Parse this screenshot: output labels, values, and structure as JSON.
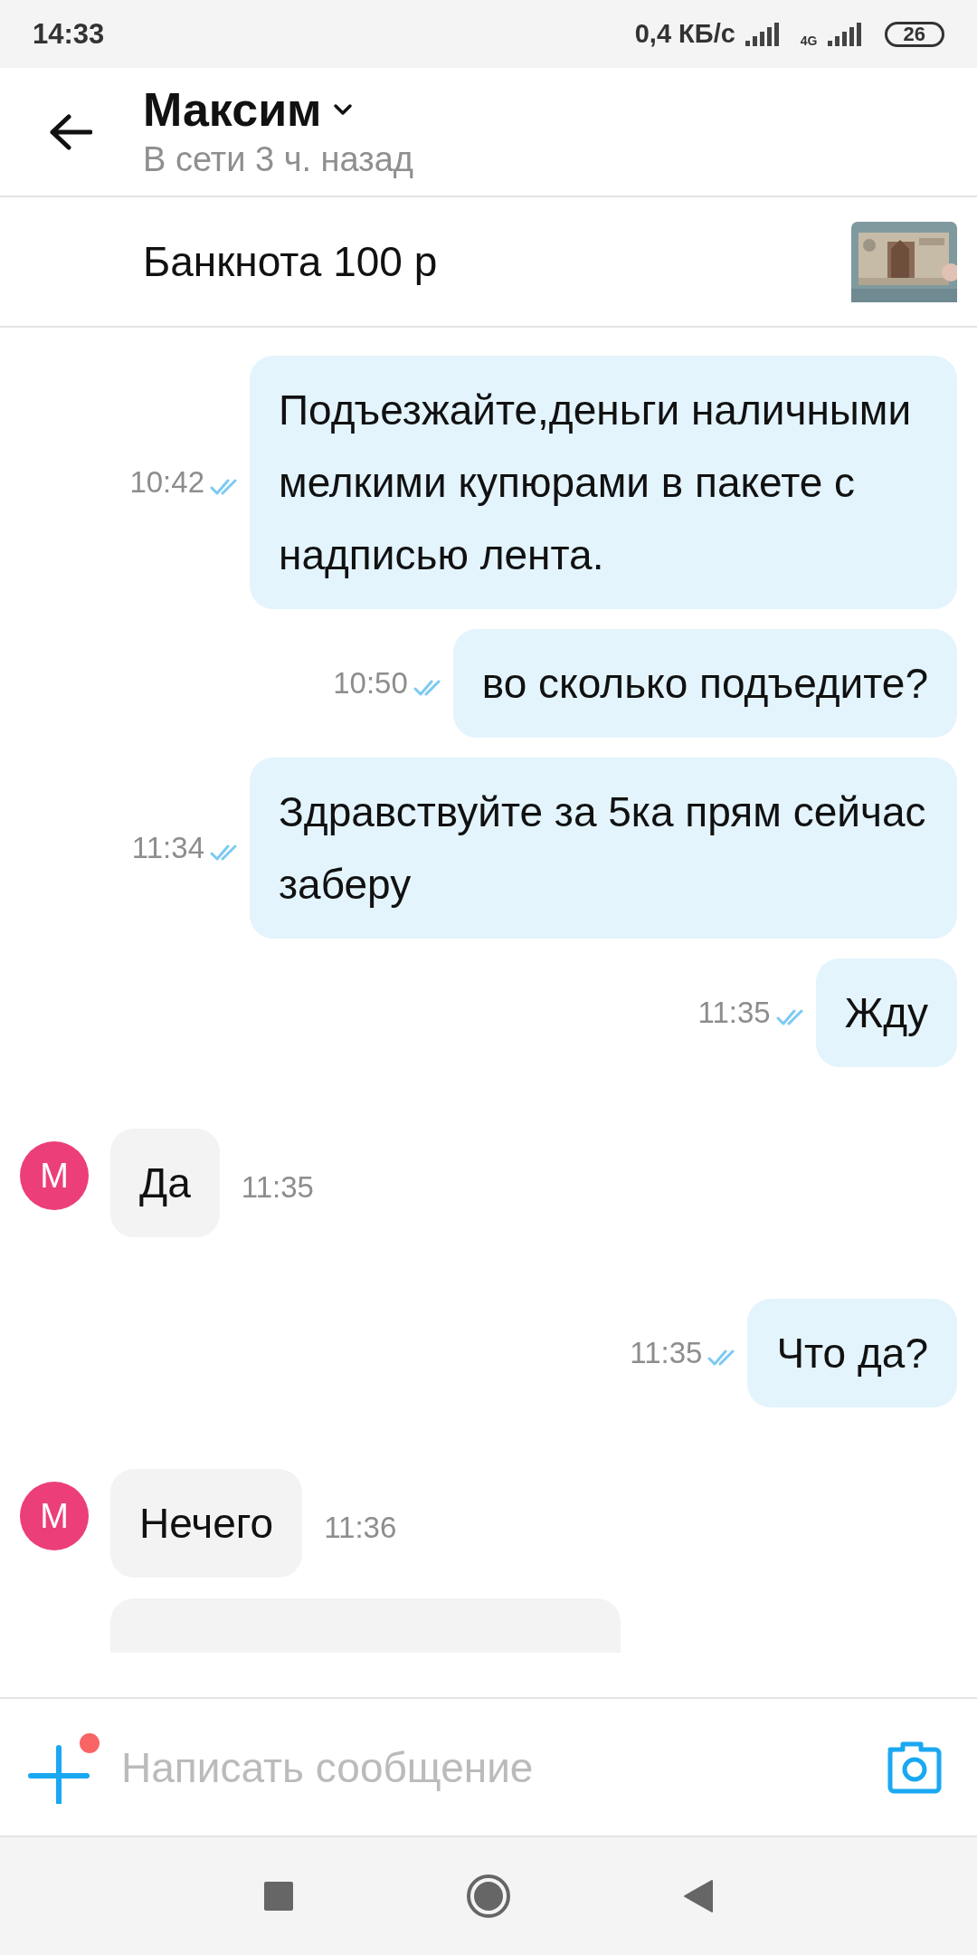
{
  "status_bar": {
    "time": "14:33",
    "speed": "0,4 КБ/с",
    "network": "4G",
    "battery": "26"
  },
  "header": {
    "name": "Максим",
    "subtitle": "В сети 3 ч. назад"
  },
  "listing": {
    "title": "Банкнота 100 р"
  },
  "messages": [
    {
      "kind": "outgoing",
      "text": "Подъезжайте,деньги наличными мелкими купюрами в пакете с надписью лента.",
      "time": "10:42",
      "read": true
    },
    {
      "kind": "outgoing",
      "text": "во сколько подъедите?",
      "time": "10:50",
      "read": true
    },
    {
      "kind": "outgoing",
      "text": "Здравствуйте за 5ка прям сейчас заберу",
      "time": "11:34",
      "read": true
    },
    {
      "kind": "outgoing",
      "text": "Жду",
      "time": "11:35",
      "read": true
    },
    {
      "kind": "incoming",
      "avatar": "М",
      "text": "Да",
      "time": "11:35"
    },
    {
      "kind": "outgoing",
      "text": "Что да?",
      "time": "11:35",
      "read": true
    },
    {
      "kind": "incoming",
      "avatar": "М",
      "text": "Нечего",
      "time": "11:36"
    },
    {
      "kind": "incoming_cut"
    }
  ],
  "composer": {
    "placeholder": "Написать сообщение",
    "attach_badge": true
  }
}
